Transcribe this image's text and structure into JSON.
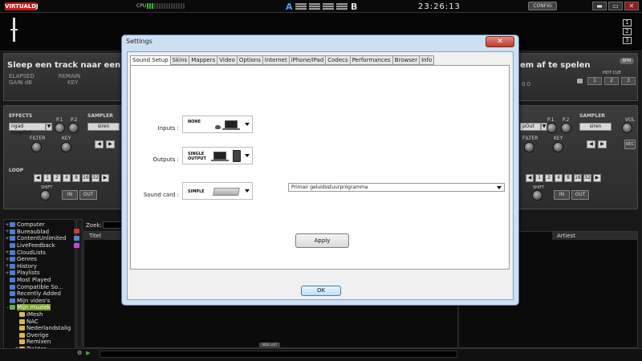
{
  "topbar": {
    "logo": "VIRTUALDJ",
    "cpu_label": "CPU",
    "deck_a": "A",
    "deck_b": "B",
    "clock": "23:26:13",
    "config_label": "CONFIG",
    "win_min": "▬",
    "win_max": "▭",
    "win_close": "✕"
  },
  "waveform": {
    "deck_numbers": [
      "1",
      "2",
      "3"
    ]
  },
  "left_track": {
    "title": "Sleep een track naar een deck",
    "elapsed": "ELAPSED",
    "remain": "REMAIN",
    "gain": "GAIN dB",
    "key": "KEY"
  },
  "right_track": {
    "title": "em af te spelen",
    "bpm": "BPM",
    "gain_val": "0.0",
    "hotcue_label": "HOT CUE",
    "hotcue": [
      "1",
      "2",
      "3"
    ]
  },
  "left_deck": {
    "effects": "EFFECTS",
    "effect_value": "ngad LoopOut",
    "p1": "P.1",
    "p2": "P.2",
    "sampler": "SAMPLER",
    "sampler_value": "siren",
    "filter": "FILTER",
    "key": "KEY",
    "loop": "LOOP",
    "loop_values": [
      "1",
      "2",
      "4",
      "8",
      "16",
      "32"
    ],
    "shift": "SHIFT",
    "in": "IN",
    "out": "OUT"
  },
  "right_deck": {
    "effect_value": "pOut",
    "p1": "P.1",
    "p2": "P.2",
    "sampler": "SAMPLER",
    "sampler_value": "siren",
    "vol": "VOL",
    "filter": "FILTER",
    "key": "KEY",
    "rec": "REC",
    "loop_values": [
      "1",
      "2",
      "4",
      "8",
      "16",
      "32"
    ],
    "shift": "SHIFT",
    "in": "IN",
    "out": "OUT"
  },
  "browser": {
    "tree": [
      {
        "label": "Computer",
        "exp": "+",
        "icon": "blue"
      },
      {
        "label": "Bureaublad",
        "exp": "+",
        "icon": "blue"
      },
      {
        "label": "ContentUnlimited",
        "exp": "+",
        "icon": "blue"
      },
      {
        "label": "LiveFeedback",
        "exp": "",
        "icon": "blue"
      },
      {
        "label": "CloudLists",
        "exp": "+",
        "icon": "blue"
      },
      {
        "label": "Genres",
        "exp": "+",
        "icon": "blue"
      },
      {
        "label": "History",
        "exp": "+",
        "icon": "blue"
      },
      {
        "label": "Playlists",
        "exp": "+",
        "icon": "blue"
      },
      {
        "label": "Most Played",
        "exp": "",
        "icon": "blue"
      },
      {
        "label": "Compatible So...",
        "exp": "",
        "icon": "blue"
      },
      {
        "label": "Recently Added",
        "exp": "",
        "icon": "blue"
      },
      {
        "label": "Mijn video's",
        "exp": "",
        "icon": "blue"
      },
      {
        "label": "Mijn muziek",
        "exp": "-",
        "icon": "green",
        "selected": true
      },
      {
        "label": "iMesh",
        "exp": "",
        "icon": "folder",
        "indent": true
      },
      {
        "label": "NAC",
        "exp": "",
        "icon": "folder",
        "indent": true
      },
      {
        "label": "Nederlandstalig",
        "exp": "",
        "icon": "folder",
        "indent": true
      },
      {
        "label": "Overige",
        "exp": "",
        "icon": "folder",
        "indent": true
      },
      {
        "label": "Remixen",
        "exp": "",
        "icon": "folder",
        "indent": true
      },
      {
        "label": "Traktor",
        "exp": "+",
        "icon": "folder",
        "indent": true
      }
    ],
    "search_label": "Zoek:",
    "col_titel": "Titel",
    "col_artiest": "Artiest",
    "sidelist": "SIDE LIST"
  },
  "settings": {
    "title": "Settings",
    "close": "✕",
    "tabs": [
      "Sound Setup",
      "Skins",
      "Mappers",
      "Video",
      "Options",
      "Internet",
      "iPhone/iPad",
      "Codecs",
      "Performances",
      "Browser",
      "Info"
    ],
    "active_tab": 0,
    "inputs_label": "Inputs :",
    "inputs_value": "NONE",
    "outputs_label": "Outputs :",
    "outputs_value_1": "SINGLE",
    "outputs_value_2": "OUTPUT",
    "soundcard_label": "Sound card :",
    "soundcard_value": "SIMPLE",
    "driver_select": "Primair geluidsstuurprogramma",
    "apply": "Apply",
    "ok": "OK"
  },
  "colors": {
    "logo_red": "#c21a1a",
    "deck_a_blue": "#4aa4ff",
    "dialog_frame": "#cde0f3",
    "selected_green": "#7a9d2c"
  }
}
